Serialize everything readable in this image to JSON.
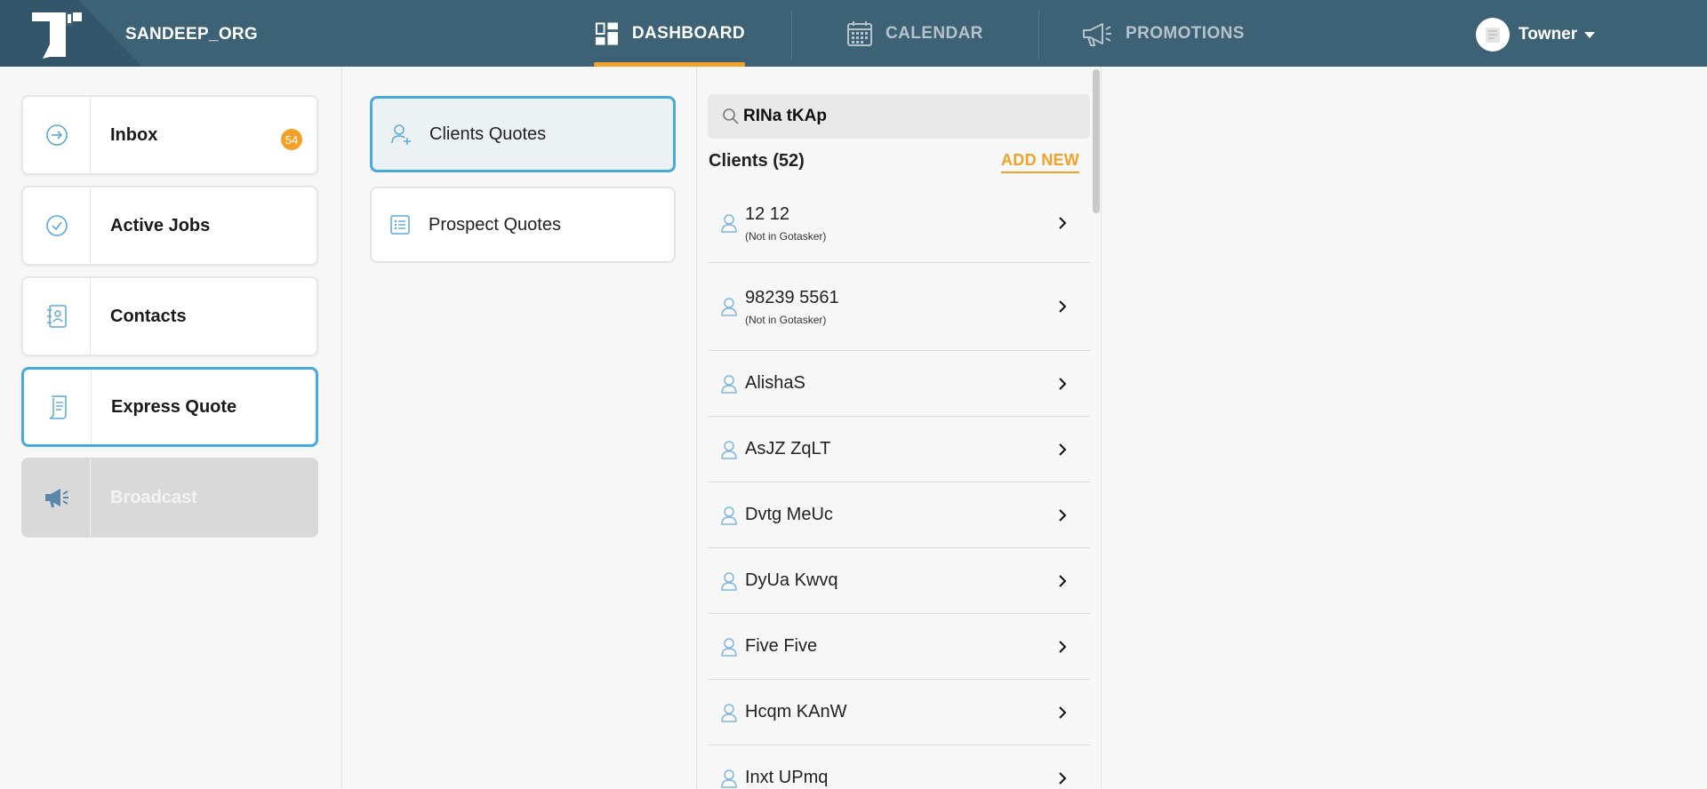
{
  "header": {
    "org_name": "SANDEEP_ORG",
    "nav": [
      {
        "label": "DASHBOARD",
        "icon": "dashboard-icon",
        "active": true
      },
      {
        "label": "CALENDAR",
        "icon": "calendar-icon",
        "active": false
      },
      {
        "label": "PROMOTIONS",
        "icon": "megaphone-icon",
        "active": false
      }
    ],
    "user_name": "Towner",
    "accent_color": "#f2a229",
    "bar_color": "#3d6175"
  },
  "sidebar": {
    "items": [
      {
        "label": "Inbox",
        "icon": "arrow-circle-icon",
        "badge": "54"
      },
      {
        "label": "Active Jobs",
        "icon": "check-circle-icon"
      },
      {
        "label": "Contacts",
        "icon": "address-book-icon"
      },
      {
        "label": "Express Quote",
        "icon": "scroll-icon",
        "selected": true
      },
      {
        "label": "Broadcast",
        "icon": "megaphone-icon",
        "disabled": true
      }
    ]
  },
  "quotes": {
    "items": [
      {
        "label": "Clients Quotes",
        "icon": "add-person-icon",
        "selected": true
      },
      {
        "label": "Prospect Quotes",
        "icon": "list-icon"
      }
    ]
  },
  "clients": {
    "search_value": "RINa tKAp",
    "heading": "Clients (52)",
    "add_new_label": "ADD NEW",
    "rows": [
      {
        "name": "12 12",
        "sub": "(Not in Gotasker)"
      },
      {
        "name": "98239 5561",
        "sub": "(Not in Gotasker)"
      },
      {
        "name": "AlishaS"
      },
      {
        "name": "AsJZ ZqLT"
      },
      {
        "name": "Dvtg MeUc"
      },
      {
        "name": "DyUa Kwvq"
      },
      {
        "name": "Five Five"
      },
      {
        "name": "Hcqm KAnW"
      },
      {
        "name": "Inxt UPmq"
      }
    ]
  }
}
